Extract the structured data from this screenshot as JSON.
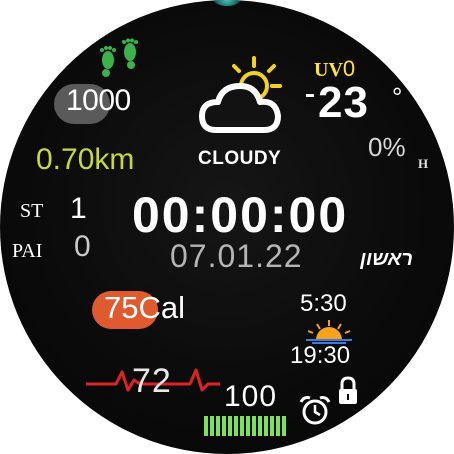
{
  "activity": {
    "steps": "1000",
    "distance": "0.70km",
    "stand_label": "ST",
    "stand_value": "1",
    "pai_label": "PAI",
    "pai_value": "0",
    "calories": "75Cal",
    "heart_rate": "72"
  },
  "weather": {
    "uv_label": "UV",
    "uv_value": "0",
    "temperature": "23",
    "degree_symbol": "°",
    "humidity": "0%",
    "humidity_label": "H",
    "condition": "CLOUDY",
    "icon": "cloud-sun-icon"
  },
  "clock": {
    "time": "00:00:00",
    "date": "07.01.22",
    "weekday": "ראשון"
  },
  "sun": {
    "sunrise": "5:30",
    "sunset": "19:30"
  },
  "battery": {
    "level": "100",
    "bars": 14,
    "bar_color": "#7de25a"
  },
  "colors": {
    "steps_pill": "#5a5a5a",
    "distance": "#c6d93a",
    "uv": "#ffe33a",
    "calories_pill": "#e05a2f",
    "heart_line": "#e02222",
    "footprint": "#3bb34a"
  }
}
